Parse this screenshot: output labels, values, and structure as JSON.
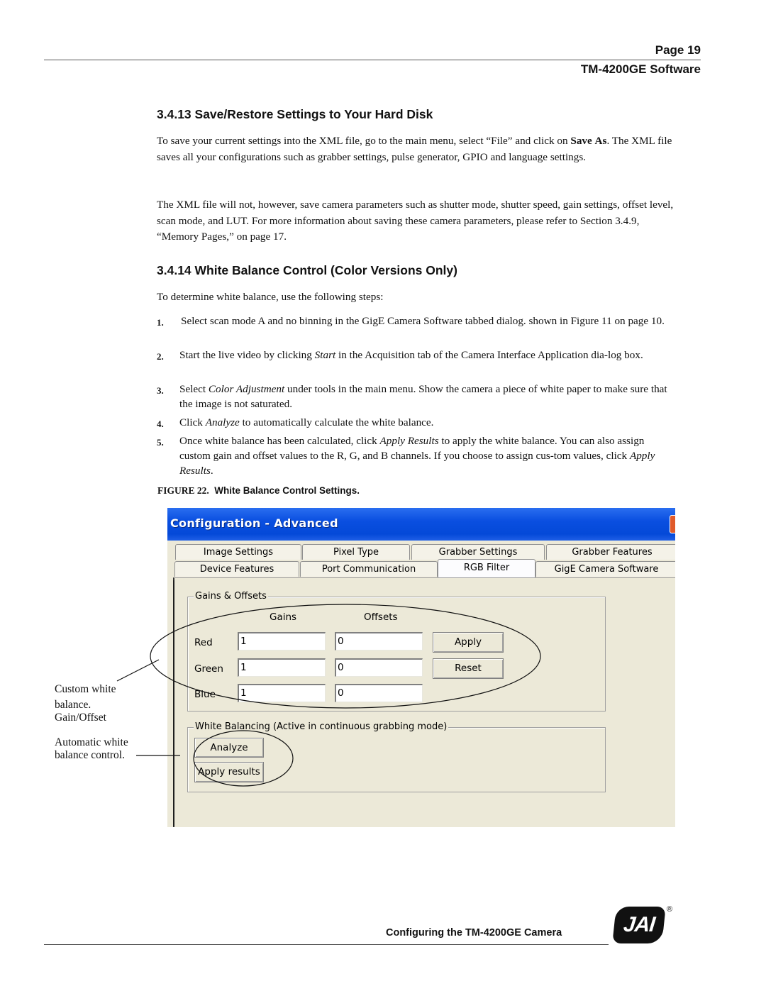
{
  "header": {
    "page": "Page 19",
    "section": "TM-4200GE Software"
  },
  "section_3_4_13": {
    "heading": "3.4.13  Save/Restore Settings to Your Hard Disk",
    "para1_a": "To save your current settings into the XML file, go to the main menu, select “File” and  click on ",
    "para1_bold1": "Save",
    "para1_bold2": "As",
    "para1_b": ". The XML file saves all your configurations such as grabber settings, pulse generator, GPIO and language settings.",
    "para2": "The XML file will not, however, save camera parameters such as shutter mode, shutter speed, gain settings, offset level, scan mode, and LUT. For more information about saving these camera parameters, please refer to Section 3.4.9, “Memory Pages,” on page 17."
  },
  "section_3_4_14": {
    "heading": "3.4.14  White Balance Control (Color Versions Only)",
    "intro": "To determine white balance, use the following steps:",
    "steps": [
      {
        "num": "1.",
        "pre": "Select  scan mode A and no binning  in the GigE Camera Software tabbed dialog. shown in Figure 11 on page 10.",
        "em": "",
        "post": ""
      },
      {
        "num": "2.",
        "pre": "Start the live video by clicking ",
        "em": "Start",
        "post": " in the Acquisition tab of the Camera Interface Application dia-log box."
      },
      {
        "num": "3.",
        "pre": "Select ",
        "em": "Color Adjustment",
        "post": " under tools in the main menu. Show the camera a piece of white paper to make sure that the image is not saturated."
      },
      {
        "num": "4.",
        "pre": "Click ",
        "em": "Analyze",
        "post": " to automatically calculate the white balance."
      },
      {
        "num": "5.",
        "pre": "Once white balance has been calculated, click ",
        "em": "Apply Results",
        "post": " to apply the white balance. You can also assign custom gain and offset values to the R, G, and B channels. If you choose to assign cus-tom values, click ",
        "em2": "Apply Results",
        "post2": "."
      }
    ]
  },
  "figure": {
    "label": "FIGURE 22.",
    "caption": "White Balance Control Settings."
  },
  "callouts": {
    "custom": [
      "Custom white",
      "balance.",
      "Gain/Offset"
    ],
    "auto": [
      "Automatic white",
      "balance control."
    ]
  },
  "dialog": {
    "title": "Configuration - Advanced",
    "tabs_row1": [
      "Image Settings",
      "Pixel Type",
      "Grabber Settings",
      "Grabber Features"
    ],
    "tabs_row2": [
      "Device Features",
      "Port Communication",
      "RGB Filter",
      "GigE Camera Software"
    ],
    "active_tab": "RGB Filter",
    "gains_offsets": {
      "legend": "Gains & Offsets",
      "col_gains": "Gains",
      "col_offsets": "Offsets",
      "rows": [
        {
          "label": "Red",
          "gain": "1",
          "offset": "0"
        },
        {
          "label": "Green",
          "gain": "1",
          "offset": "0"
        },
        {
          "label": "Blue",
          "gain": "1",
          "offset": "0"
        }
      ],
      "apply_button": "Apply",
      "reset_button": "Reset"
    },
    "white_balancing": {
      "legend": "White Balancing (Active in continuous grabbing mode)",
      "analyze_button": "Analyze",
      "apply_results_button": "Apply results"
    }
  },
  "footer": {
    "text": "Configuring the TM-4200GE Camera",
    "logo": "JAI",
    "registered": "®"
  },
  "colors": {
    "titlebar": "#0449d8",
    "dialog_bg": "#ece9d8",
    "close_button": "#e05a2a"
  }
}
